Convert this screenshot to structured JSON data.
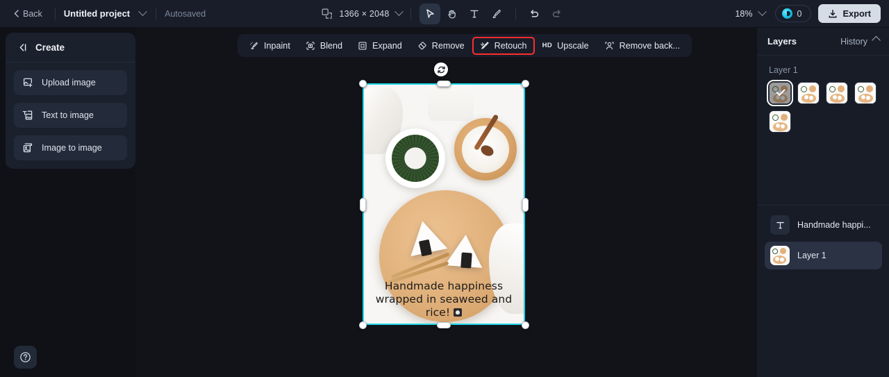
{
  "topbar": {
    "back_label": "Back",
    "project_name": "Untitled project",
    "autosave_label": "Autosaved",
    "canvas_size": "1366 × 2048",
    "zoom_level": "18%",
    "credits_count": "0",
    "export_label": "Export",
    "tools": [
      {
        "name": "select-tool",
        "title": "Select",
        "active": true
      },
      {
        "name": "hand-tool",
        "title": "Hand",
        "active": false
      },
      {
        "name": "text-tool",
        "title": "Text",
        "active": false
      },
      {
        "name": "brush-tool",
        "title": "Brush",
        "active": false
      },
      {
        "name": "undo-tool",
        "title": "Undo",
        "active": false
      },
      {
        "name": "redo-tool",
        "title": "Redo",
        "active": false
      }
    ]
  },
  "create_panel": {
    "title": "Create",
    "items": [
      {
        "label": "Upload image",
        "icon": "upload-image-icon"
      },
      {
        "label": "Text to image",
        "icon": "text-to-image-icon"
      },
      {
        "label": "Image to image",
        "icon": "image-to-image-icon"
      }
    ]
  },
  "edit_toolbar": {
    "items": [
      {
        "label": "Inpaint",
        "icon": "inpaint-icon",
        "highlighted": false
      },
      {
        "label": "Blend",
        "icon": "blend-icon",
        "highlighted": false
      },
      {
        "label": "Expand",
        "icon": "expand-icon",
        "highlighted": false
      },
      {
        "label": "Remove",
        "icon": "remove-icon",
        "highlighted": false
      },
      {
        "label": "Retouch",
        "icon": "retouch-icon",
        "highlighted": true
      },
      {
        "label": "Upscale",
        "icon": "hd-icon",
        "highlighted": false
      },
      {
        "label": "Remove back...",
        "icon": "remove-background-icon",
        "highlighted": false
      }
    ]
  },
  "right_panel": {
    "title": "Layers",
    "history_label": "History",
    "layer_group_label": "Layer 1",
    "variation_count": 5,
    "selected_variation": 0,
    "layers": [
      {
        "name": "Handmade happi...",
        "type": "text",
        "active": false
      },
      {
        "name": "Layer 1",
        "type": "image",
        "active": true
      }
    ]
  },
  "canvas": {
    "caption_line1": "Handmade happiness",
    "caption_line2": "wrapped in seaweed and",
    "caption_line3": "rice!",
    "caption_emoji": "rice-ball-emoji",
    "selection_color": "#1ed6e6"
  },
  "help": {
    "label": "help-icon"
  }
}
